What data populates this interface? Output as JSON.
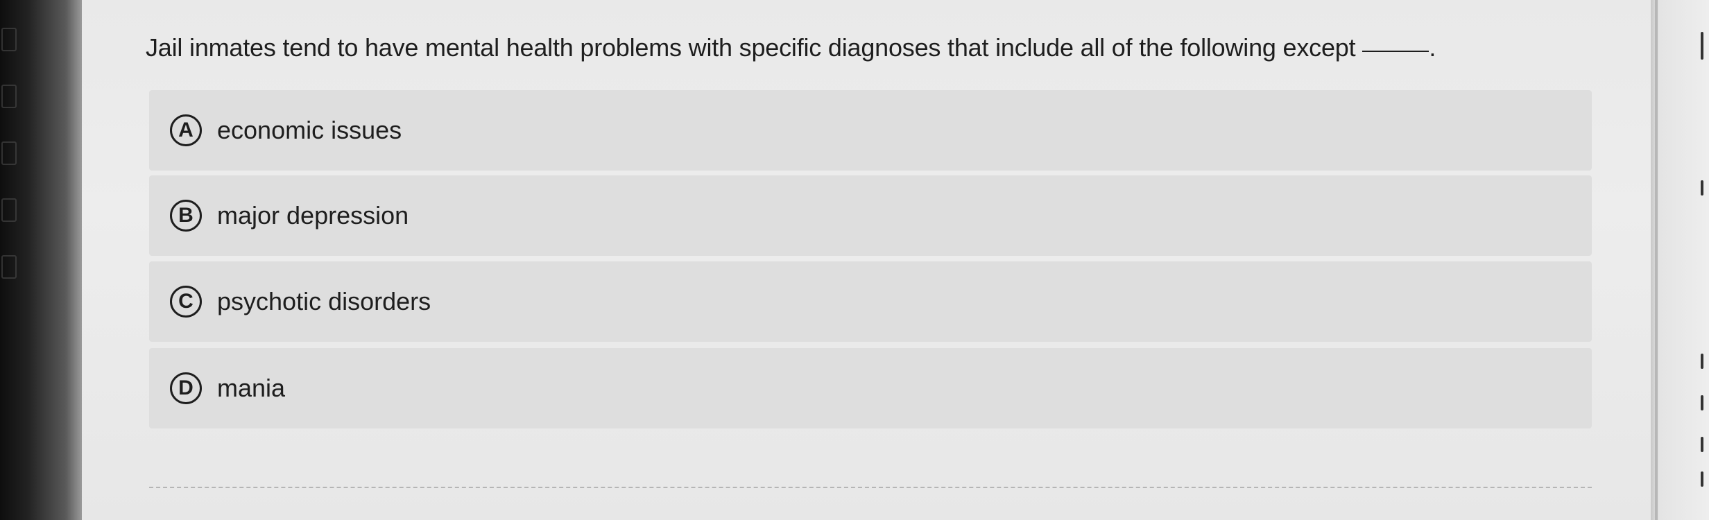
{
  "question": {
    "text": "Jail inmates tend to have mental health problems with specific diagnoses that include all of the following except",
    "end_punct": "."
  },
  "options": [
    {
      "letter": "A",
      "label": "economic issues"
    },
    {
      "letter": "B",
      "label": "major depression"
    },
    {
      "letter": "C",
      "label": "psychotic disorders"
    },
    {
      "letter": "D",
      "label": "mania"
    }
  ],
  "colors": {
    "option_bg": "#dedede",
    "panel_bg": "#ebebeb",
    "text": "#1e1e1e"
  }
}
